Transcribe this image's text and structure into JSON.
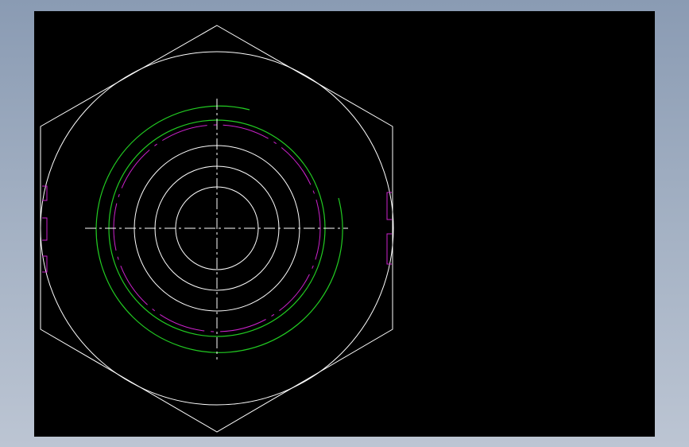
{
  "viewport": {
    "background": "#000000",
    "frame_background": "#a6b3c5"
  },
  "drawing": {
    "colors": {
      "outline": "#ffffff",
      "thread": "#22cc22",
      "hidden": "#cc22cc",
      "centerline": "#ffffff"
    },
    "view": "hex-nut-top-view"
  }
}
